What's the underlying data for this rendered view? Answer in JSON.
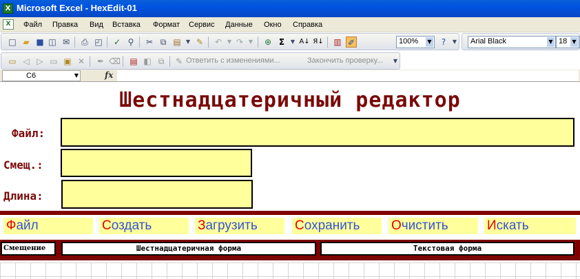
{
  "window": {
    "title": "Microsoft Excel - HexEdit-01",
    "app_icon": "excel-icon"
  },
  "menu": {
    "doc_icon": "excel-document-icon",
    "items": [
      {
        "label": "Файл"
      },
      {
        "label": "Правка"
      },
      {
        "label": "Вид"
      },
      {
        "label": "Вставка"
      },
      {
        "label": "Формат"
      },
      {
        "label": "Сервис"
      },
      {
        "label": "Данные"
      },
      {
        "label": "Окно"
      },
      {
        "label": "Справка"
      }
    ]
  },
  "toolbar": {
    "standard_icons": [
      "new-icon",
      "open-icon",
      "save-icon",
      "permission-icon",
      "email-icon",
      "print-icon",
      "print-preview-icon",
      "spelling-icon",
      "research-icon",
      "cut-icon",
      "copy-icon",
      "paste-icon",
      "format-painter-icon",
      "undo-icon",
      "redo-icon",
      "hyperlink-icon",
      "autosum-icon",
      "sort-ascending-icon",
      "sort-descending-icon",
      "chart-wizard-icon",
      "drawing-icon",
      "help-icon"
    ],
    "zoom": "100%",
    "font_name": "Arial Black",
    "font_size": "18"
  },
  "review_toolbar": {
    "reply_label": "Ответить с изменениями...",
    "end_review_label": "Закончить проверку..."
  },
  "formula_bar": {
    "cell_ref": "C6",
    "fx_label": "fx",
    "formula": ""
  },
  "sheet": {
    "title": "Шестнадцатеричный редактор",
    "fields": {
      "file_label": "Файл:",
      "offset_label": "Смещ.:",
      "length_label": "Длина:",
      "file_value": "",
      "offset_value": "",
      "length_value": ""
    },
    "buttons": [
      {
        "first": "Ф",
        "rest": "айл"
      },
      {
        "first": "С",
        "rest": "оздать"
      },
      {
        "first": "З",
        "rest": "агрузить"
      },
      {
        "first": "С",
        "rest": "охранить"
      },
      {
        "first": "О",
        "rest": "чистить"
      },
      {
        "first": "И",
        "rest": "скать"
      }
    ],
    "headers": {
      "offset": "Смещение",
      "hex": "Шестнадцатеричная форма",
      "text": "Текстовая форма"
    }
  },
  "colors": {
    "title_bar": "#0053e1",
    "dark_red": "#800000",
    "cell_yellow": "#ffff9c",
    "button_blue": "#3454d1",
    "button_red": "#e00000"
  }
}
